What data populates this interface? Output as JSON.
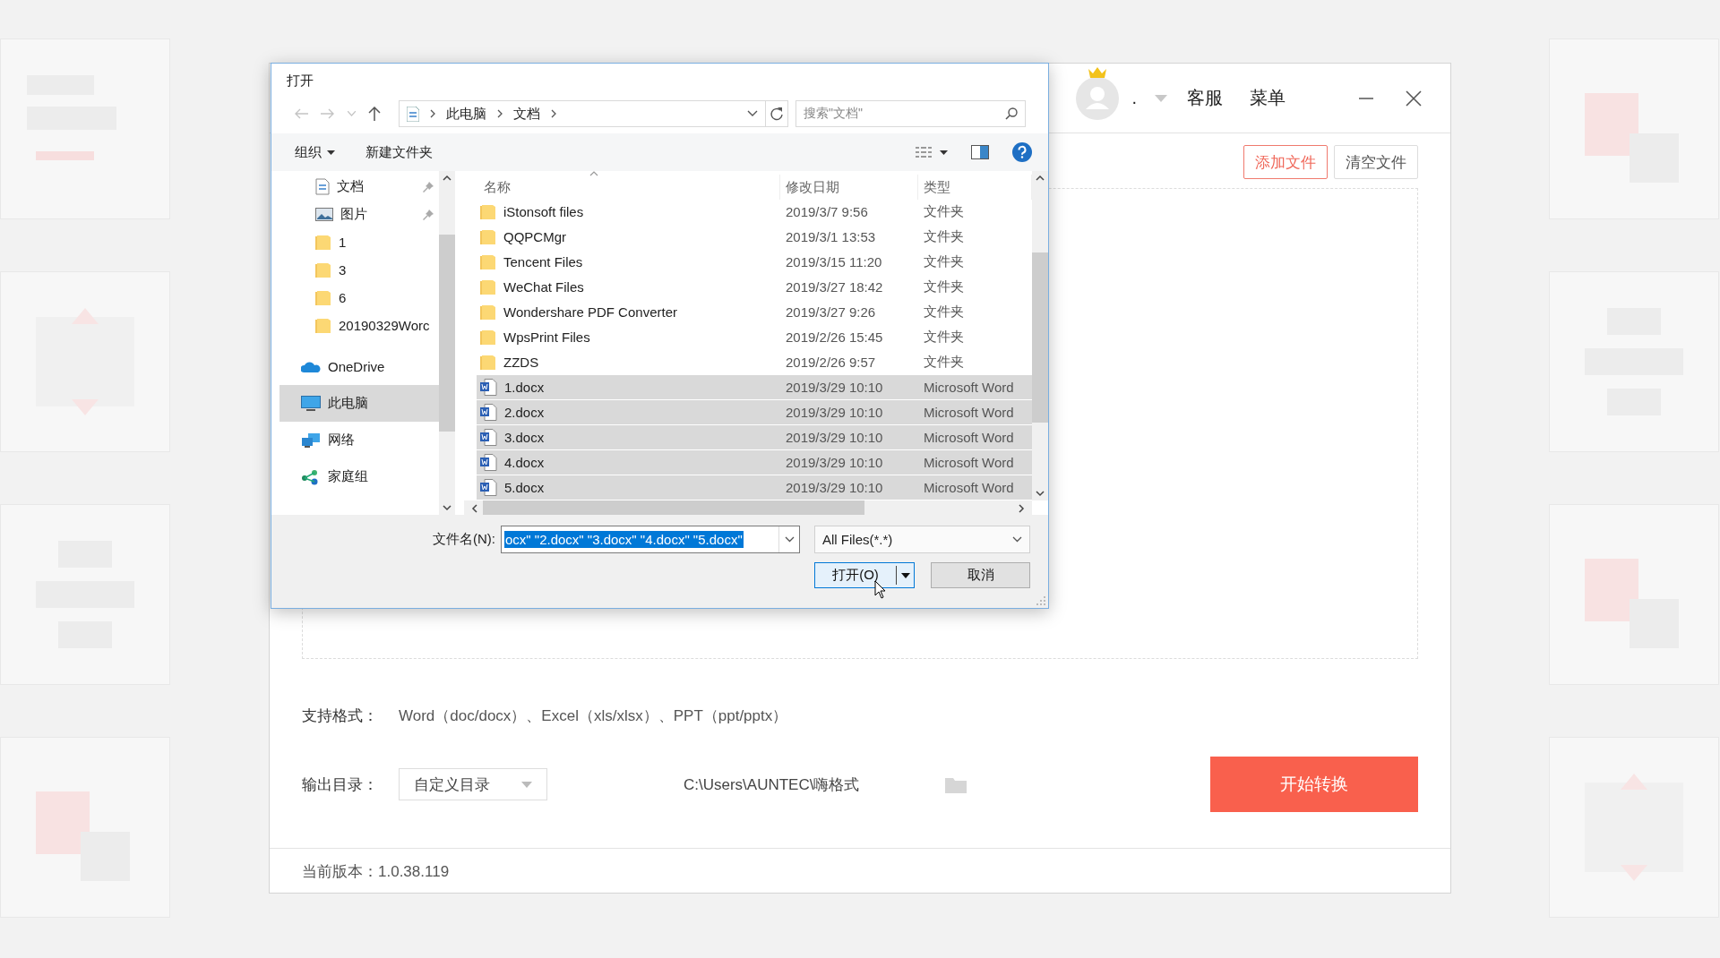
{
  "app": {
    "header": {
      "user_name": ".",
      "links": [
        "客服",
        "菜单"
      ]
    },
    "buttons": [
      {
        "label": "添加文件",
        "kind": "primary"
      },
      {
        "label": "清空文件",
        "kind": "plain"
      }
    ],
    "formats": {
      "label": "支持格式：",
      "value": "Word（doc/docx）、Excel（xls/xlsx）、PPT（ppt/pptx）"
    },
    "output": {
      "label": "输出目录：",
      "mode": "自定义目录",
      "path": "C:\\Users\\AUNTEC\\嗨格式"
    },
    "start_button": "开始转换",
    "version": "当前版本：1.0.38.119"
  },
  "dialog": {
    "title": "打开",
    "breadcrumb": [
      "此电脑",
      "文档"
    ],
    "search": {
      "placeholder": "搜索\"文档\""
    },
    "toolbar": {
      "organize": "组织",
      "new_folder": "新建文件夹"
    },
    "sidebar": {
      "items": [
        {
          "label": "文档",
          "kind": "documents",
          "pinned": true,
          "selected": false
        },
        {
          "label": "图片",
          "kind": "pictures",
          "pinned": true,
          "selected": false
        },
        {
          "label": "1",
          "kind": "folder",
          "pinned": false,
          "selected": false
        },
        {
          "label": "3",
          "kind": "folder",
          "pinned": false,
          "selected": false
        },
        {
          "label": "6",
          "kind": "folder",
          "pinned": false,
          "selected": false
        },
        {
          "label": "20190329Worc",
          "kind": "folder",
          "pinned": false,
          "selected": false
        },
        {
          "label": "OneDrive",
          "kind": "cloud",
          "pinned": false,
          "selected": false
        },
        {
          "label": "此电脑",
          "kind": "computer",
          "pinned": false,
          "selected": true
        },
        {
          "label": "网络",
          "kind": "network",
          "pinned": false,
          "selected": false
        },
        {
          "label": "家庭组",
          "kind": "homegroup",
          "pinned": false,
          "selected": false
        }
      ]
    },
    "table": {
      "columns": [
        {
          "label": "名称",
          "sorted": true
        },
        {
          "label": "修改日期",
          "sorted": false
        },
        {
          "label": "类型",
          "sorted": false
        }
      ],
      "rows": [
        {
          "name": "iStonsoft files",
          "date": "2019/3/7 9:56",
          "type": "文件夹",
          "kind": "folder",
          "selected": false
        },
        {
          "name": "QQPCMgr",
          "date": "2019/3/1 13:53",
          "type": "文件夹",
          "kind": "folder",
          "selected": false
        },
        {
          "name": "Tencent Files",
          "date": "2019/3/15 11:20",
          "type": "文件夹",
          "kind": "folder",
          "selected": false
        },
        {
          "name": "WeChat Files",
          "date": "2019/3/27 18:42",
          "type": "文件夹",
          "kind": "folder",
          "selected": false
        },
        {
          "name": "Wondershare PDF Converter",
          "date": "2019/3/27 9:26",
          "type": "文件夹",
          "kind": "folder",
          "selected": false
        },
        {
          "name": "WpsPrint Files",
          "date": "2019/2/26 15:45",
          "type": "文件夹",
          "kind": "folder",
          "selected": false
        },
        {
          "name": "ZZDS",
          "date": "2019/2/26 9:57",
          "type": "文件夹",
          "kind": "folder",
          "selected": false
        },
        {
          "name": "1.docx",
          "date": "2019/3/29 10:10",
          "type": "Microsoft Word",
          "kind": "word",
          "selected": true
        },
        {
          "name": "2.docx",
          "date": "2019/3/29 10:10",
          "type": "Microsoft Word",
          "kind": "word",
          "selected": true
        },
        {
          "name": "3.docx",
          "date": "2019/3/29 10:10",
          "type": "Microsoft Word",
          "kind": "word",
          "selected": true
        },
        {
          "name": "4.docx",
          "date": "2019/3/29 10:10",
          "type": "Microsoft Word",
          "kind": "word",
          "selected": true
        },
        {
          "name": "5.docx",
          "date": "2019/3/29 10:10",
          "type": "Microsoft Word",
          "kind": "word",
          "selected": true
        }
      ]
    },
    "file_name": {
      "label": "文件名(N):",
      "value": "ocx\" \"2.docx\" \"3.docx\" \"4.docx\" \"5.docx\"",
      "highlighted": true
    },
    "file_type": "All Files(*.*)",
    "buttons": {
      "open": "打开(O)",
      "cancel": "取消"
    }
  }
}
